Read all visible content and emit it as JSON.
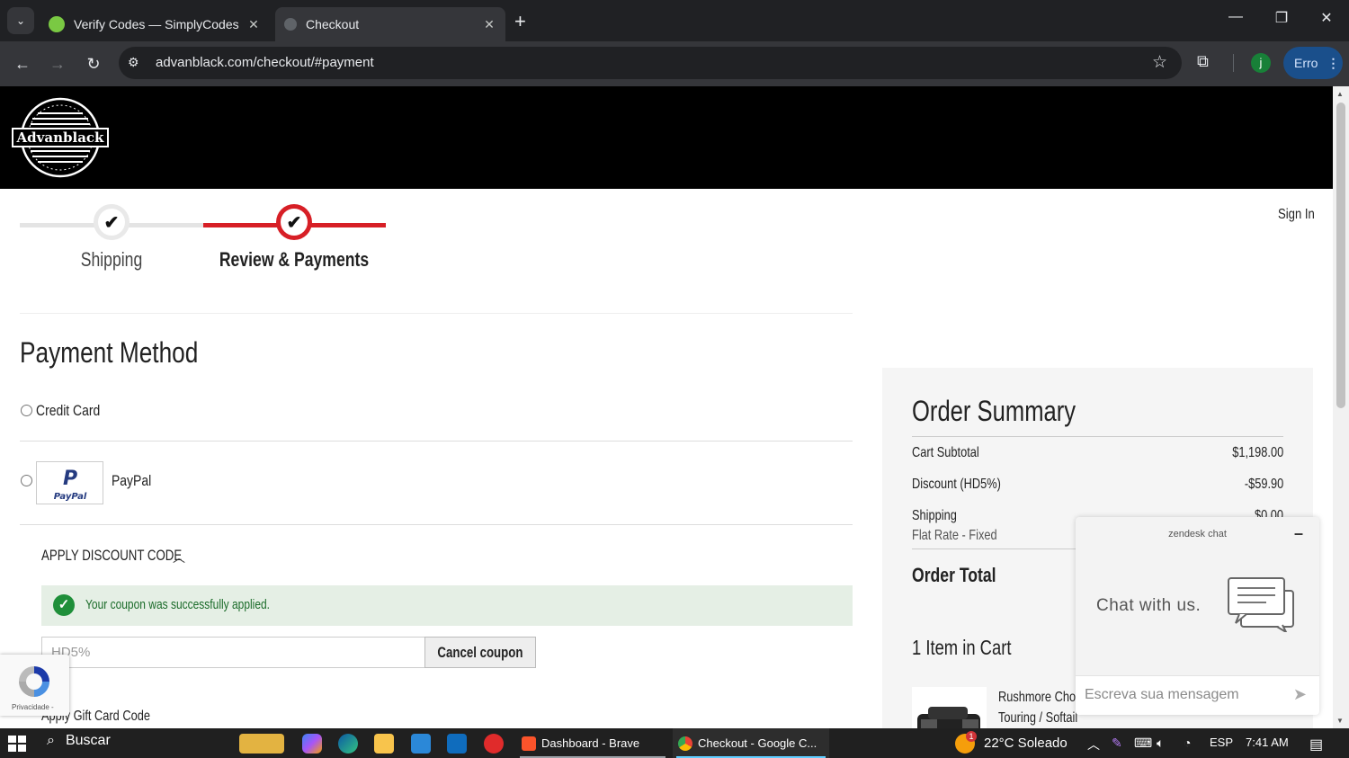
{
  "browser": {
    "tabs": [
      {
        "title": "Verify Codes — SimplyCodes",
        "active": false
      },
      {
        "title": "Checkout",
        "active": true
      }
    ],
    "url": "advanblack.com/checkout/#payment",
    "profile_initial": "j",
    "error_button_label": "Erro"
  },
  "site": {
    "logo_text": "Advanblack",
    "sign_in": "Sign In"
  },
  "progress": {
    "steps": [
      {
        "label": "Shipping",
        "state": "complete"
      },
      {
        "label": "Review & Payments",
        "state": "current"
      }
    ],
    "accent_color": "#d71f26"
  },
  "payment": {
    "title": "Payment Method",
    "options": [
      {
        "label": "Credit Card"
      },
      {
        "label": "PayPal"
      }
    ],
    "discount_heading": "APPLY DISCOUNT CODE",
    "success_message": "Your coupon was successfully applied.",
    "coupon_value": "HD5%",
    "cancel_coupon_label": "Cancel coupon",
    "gift_card_label": "Apply Gift Card Code",
    "paypal_logo_text": "PayPal",
    "recaptcha_text": "Privacidade -"
  },
  "order_summary": {
    "title": "Order Summary",
    "rows": [
      {
        "label": "Cart Subtotal",
        "value": "$1,198.00"
      },
      {
        "label": "Discount (HD5%)",
        "value": "-$59.90"
      },
      {
        "label": "Shipping",
        "sublabel": "Flat Rate - Fixed",
        "value": "$0.00"
      }
    ],
    "total_label": "Order Total",
    "items_in_cart": "1 Item in Cart",
    "product_name_lines": [
      "Rushmore Chop",
      "Touring / Softail"
    ]
  },
  "chat": {
    "header": "zendesk chat",
    "minimize": "–",
    "prompt": "Chat with us.",
    "input_placeholder": "Escreva sua mensagem"
  },
  "taskbar": {
    "search_label": "Buscar",
    "apps": [
      {
        "label": "Dashboard - Brave"
      },
      {
        "label": "Checkout - Google C..."
      }
    ],
    "weather": "22°C  Soleado",
    "language": "ESP",
    "time": "7:41 AM",
    "notification_badge": "1"
  }
}
